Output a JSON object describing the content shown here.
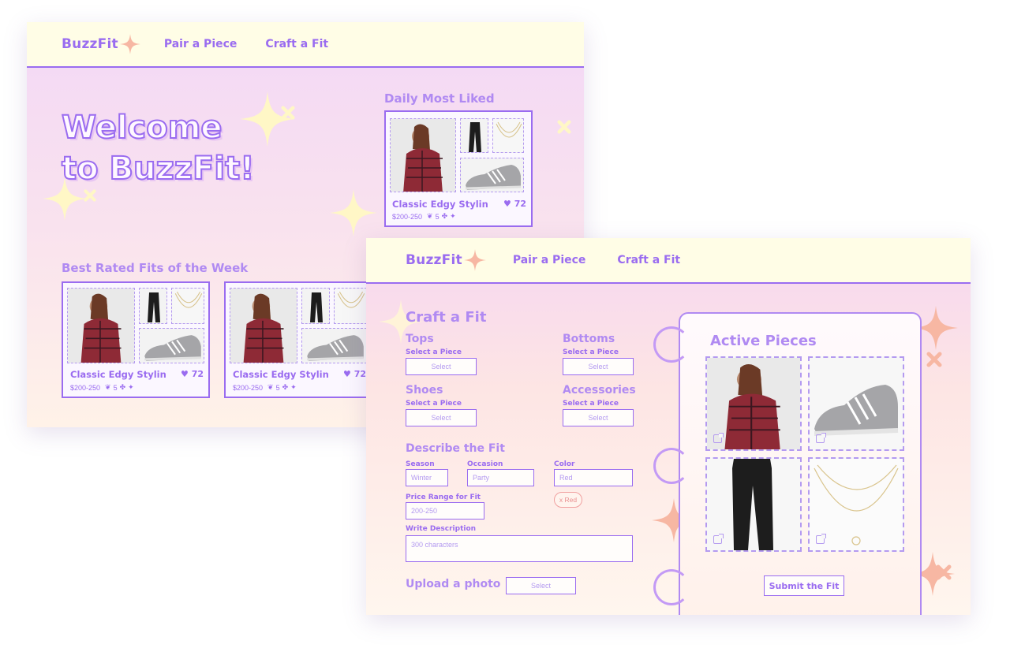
{
  "screen1": {
    "brand": "BuzzFit",
    "nav": [
      "Pair a Piece",
      "Craft a Fit"
    ],
    "hero_line1": "Welcome",
    "hero_line2": "to BuzzFit!",
    "daily_heading": "Daily Most Liked",
    "best_heading": "Best Rated Fits of the Week",
    "card": {
      "title": "Classic Edgy Stylin",
      "price": "$200-250",
      "rating": "5",
      "likes": "72"
    }
  },
  "screen2": {
    "brand": "BuzzFit",
    "nav": [
      "Pair a Piece",
      "Craft a Fit"
    ],
    "title": "Craft a Fit",
    "categories": [
      {
        "name": "Tops",
        "hint": "Select a Piece",
        "button": "Select"
      },
      {
        "name": "Bottoms",
        "hint": "Select a Piece",
        "button": "Select"
      },
      {
        "name": "Shoes",
        "hint": "Select a Piece",
        "button": "Select"
      },
      {
        "name": "Accessories",
        "hint": "Select a Piece",
        "button": "Select"
      }
    ],
    "describe_heading": "Describe the Fit",
    "season_label": "Season",
    "season_value": "Winter",
    "occasion_label": "Occasion",
    "occasion_value": "Party",
    "color_label": "Color",
    "color_value": "Red",
    "color_chip": "x Red",
    "price_label": "Price Range for Fit",
    "price_value": "200-250",
    "desc_label": "Write Description",
    "desc_placeholder": "300 characters",
    "upload_label": "Upload a photo",
    "upload_button": "Select",
    "active_heading": "Active Pieces",
    "submit": "Submit the Fit"
  },
  "colors": {
    "accent": "#9a6cf0",
    "nav_bg": "#fffde6",
    "sparkle": "#fff6c8",
    "coral": "#f7b7a3"
  }
}
